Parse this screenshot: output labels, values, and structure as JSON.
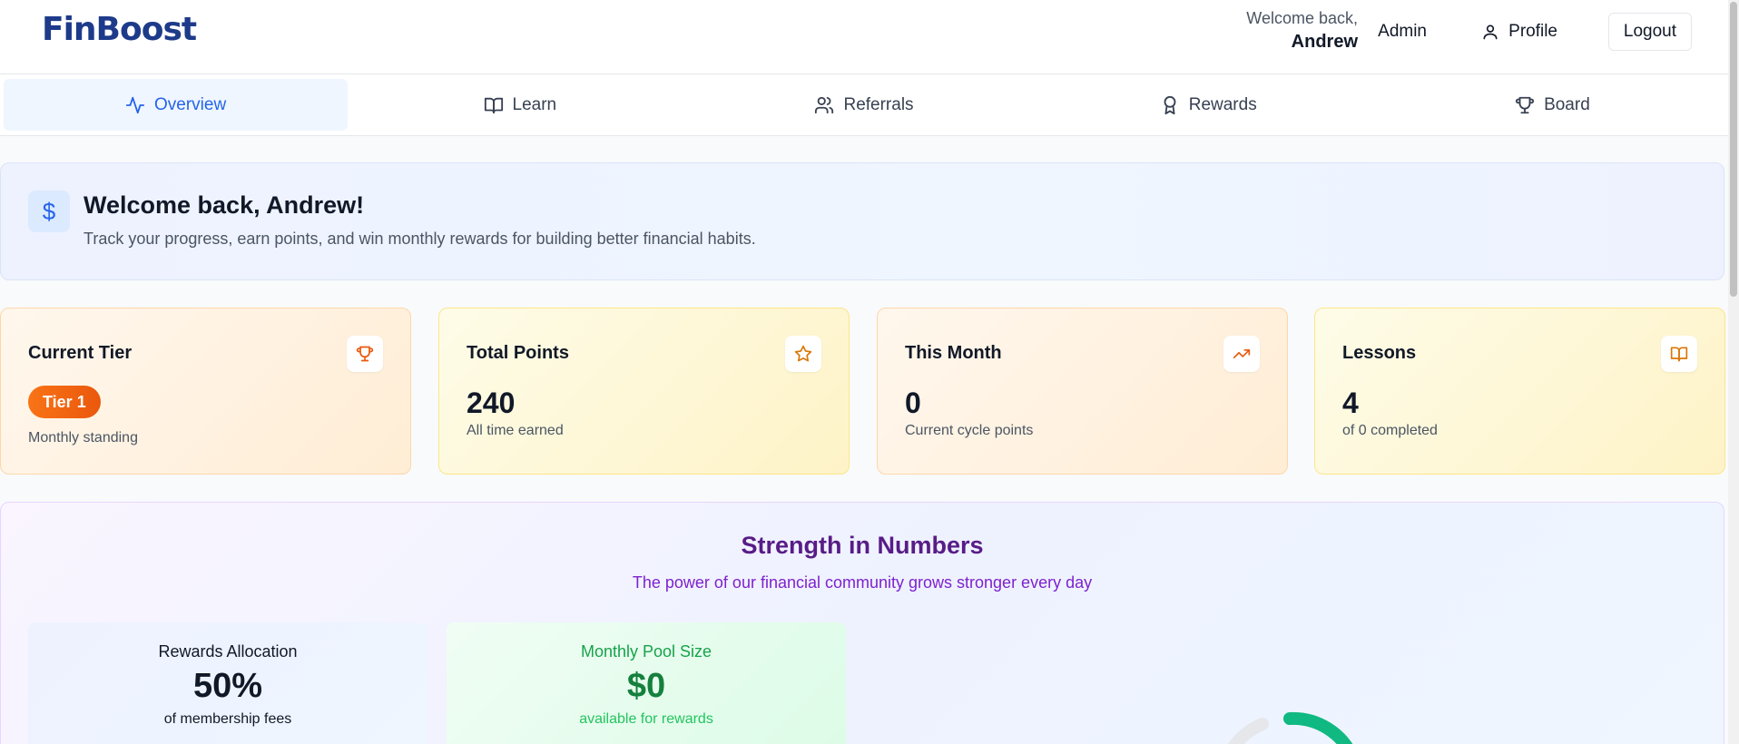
{
  "header": {
    "logo": "FinBoost",
    "welcome_small": "Welcome back,",
    "user_name": "Andrew",
    "admin_label": "Admin",
    "profile_label": "Profile",
    "logout_label": "Logout"
  },
  "nav": {
    "tabs": [
      {
        "label": "Overview",
        "icon": "activity-icon",
        "active": true
      },
      {
        "label": "Learn",
        "icon": "book-open-icon"
      },
      {
        "label": "Referrals",
        "icon": "users-icon"
      },
      {
        "label": "Rewards",
        "icon": "award-icon"
      },
      {
        "label": "Board",
        "icon": "trophy-icon"
      }
    ]
  },
  "banner": {
    "icon": "dollar-icon",
    "title": "Welcome back, Andrew!",
    "subtitle": "Track your progress, earn points, and win monthly rewards for building better financial habits."
  },
  "stats": {
    "tier": {
      "title": "Current Tier",
      "badge": "Tier 1",
      "sub": "Monthly standing",
      "icon": "trophy-icon"
    },
    "points": {
      "title": "Total Points",
      "value": "240",
      "sub": "All time earned",
      "icon": "star-icon"
    },
    "month": {
      "title": "This Month",
      "value": "0",
      "sub": "Current cycle points",
      "icon": "trending-up-icon"
    },
    "lessons": {
      "title": "Lessons",
      "value": "4",
      "sub": "of 0 completed",
      "icon": "book-open-icon"
    }
  },
  "strength": {
    "title": "Strength in Numbers",
    "subtitle": "The power of our financial community grows stronger every day",
    "allocation": {
      "label": "Rewards Allocation",
      "value": "50%",
      "sub": "of membership fees"
    },
    "pool": {
      "label": "Monthly Pool Size",
      "value": "$0",
      "sub": "available for rewards"
    }
  },
  "colors": {
    "brand": "#1e3a8a",
    "accent": "#2563eb",
    "tier_orange": "#f97316",
    "purple_title": "#581c87",
    "green": "#16a34a"
  }
}
